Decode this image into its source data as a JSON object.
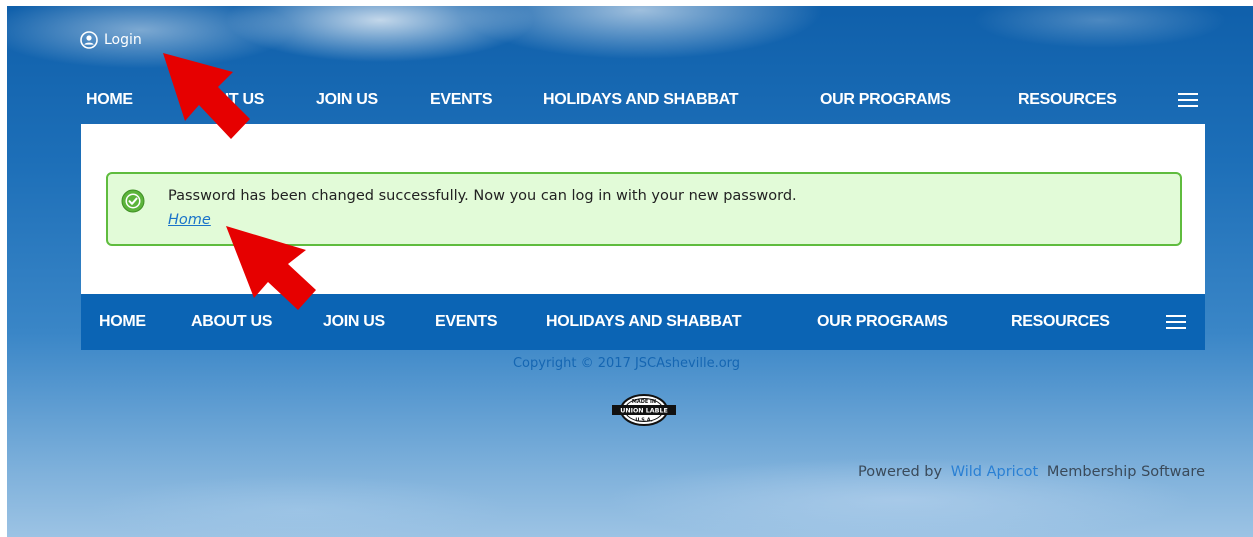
{
  "header": {
    "login_label": "Login"
  },
  "nav_top": {
    "items": [
      "HOME",
      "ABOUT US",
      "JOIN US",
      "EVENTS",
      "HOLIDAYS AND SHABBAT",
      "OUR PROGRAMS",
      "RESOURCES"
    ]
  },
  "alert": {
    "message": "Password has been changed successfully. Now you can log in with your new password.",
    "link": "Home"
  },
  "nav_bottom": {
    "items": [
      "HOME",
      "ABOUT US",
      "JOIN US",
      "EVENTS",
      "HOLIDAYS AND SHABBAT",
      "OUR PROGRAMS",
      "RESOURCES"
    ]
  },
  "footer": {
    "copyright": "Copyright © 2017 JSCAsheville.org",
    "badge": {
      "top": "MADE IN",
      "middle": "UNION LABLE",
      "bottom": "U.S.A."
    },
    "powered_prefix": "Powered by",
    "powered_brand": "Wild Apricot",
    "powered_suffix": "Membership Software"
  },
  "colors": {
    "nav_bar": "#0b64b4",
    "alert_bg": "#e2fbd8",
    "alert_border": "#5fbc3e",
    "link": "#1a73c9",
    "annotation_arrow": "#e60000"
  },
  "icons": [
    "user-circle-icon",
    "hamburger-menu-icon",
    "checkmark-circle-icon",
    "union-label-badge",
    "annotation-arrow"
  ]
}
